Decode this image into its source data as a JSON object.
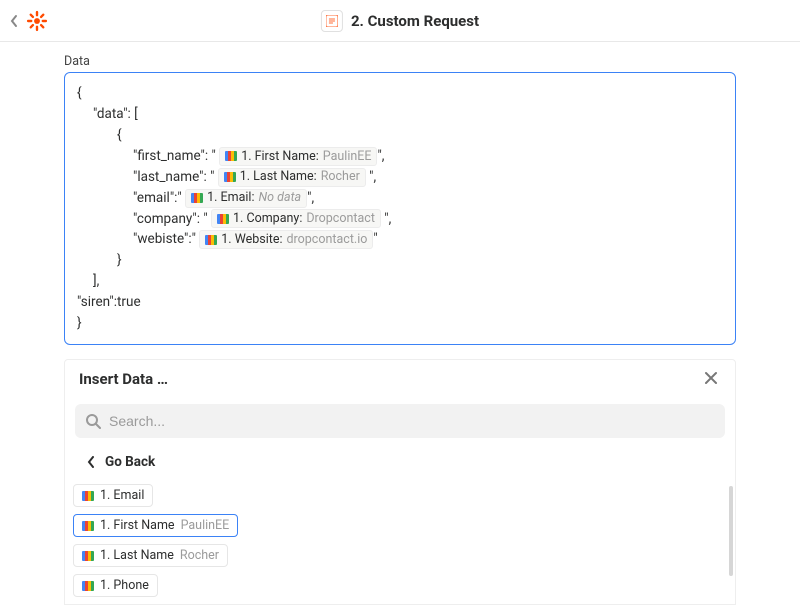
{
  "header": {
    "step_title": "2. Custom Request"
  },
  "data_section": {
    "label": "Data",
    "lines": {
      "open_brace": "{",
      "data_key": "\"data\": [",
      "inner_open": "{",
      "fn_key": "\"first_name\": \" ",
      "fn_tail": "\",",
      "ln_key": "\"last_name\": \" ",
      "ln_tail": " \",",
      "em_key": "\"email\":\" ",
      "em_tail": "\",",
      "co_key": "\"company\": \" ",
      "co_tail": " \",",
      "we_key": "\"webiste\":\" ",
      "we_tail": "\"",
      "inner_close": "}",
      "arr_close": "],",
      "siren": "\"siren\":true",
      "close_brace": "}"
    },
    "pills": {
      "first_name": {
        "label": "1. First Name:",
        "value": "PaulinEE"
      },
      "last_name": {
        "label": "1. Last Name:",
        "value": "Rocher"
      },
      "email": {
        "label": "1. Email:",
        "value": "No data"
      },
      "company": {
        "label": "1. Company:",
        "value": "Dropcontact"
      },
      "website": {
        "label": "1. Website:",
        "value": "dropcontact.io"
      }
    }
  },
  "insert": {
    "title": "Insert Data …",
    "search_placeholder": "Search...",
    "go_back": "Go Back",
    "items": [
      {
        "label": "1. Email",
        "value": "",
        "selected": false
      },
      {
        "label": "1. First Name",
        "value": "PaulinEE",
        "selected": true
      },
      {
        "label": "1. Last Name",
        "value": "Rocher",
        "selected": false
      },
      {
        "label": "1. Phone",
        "value": "",
        "selected": false
      }
    ]
  }
}
